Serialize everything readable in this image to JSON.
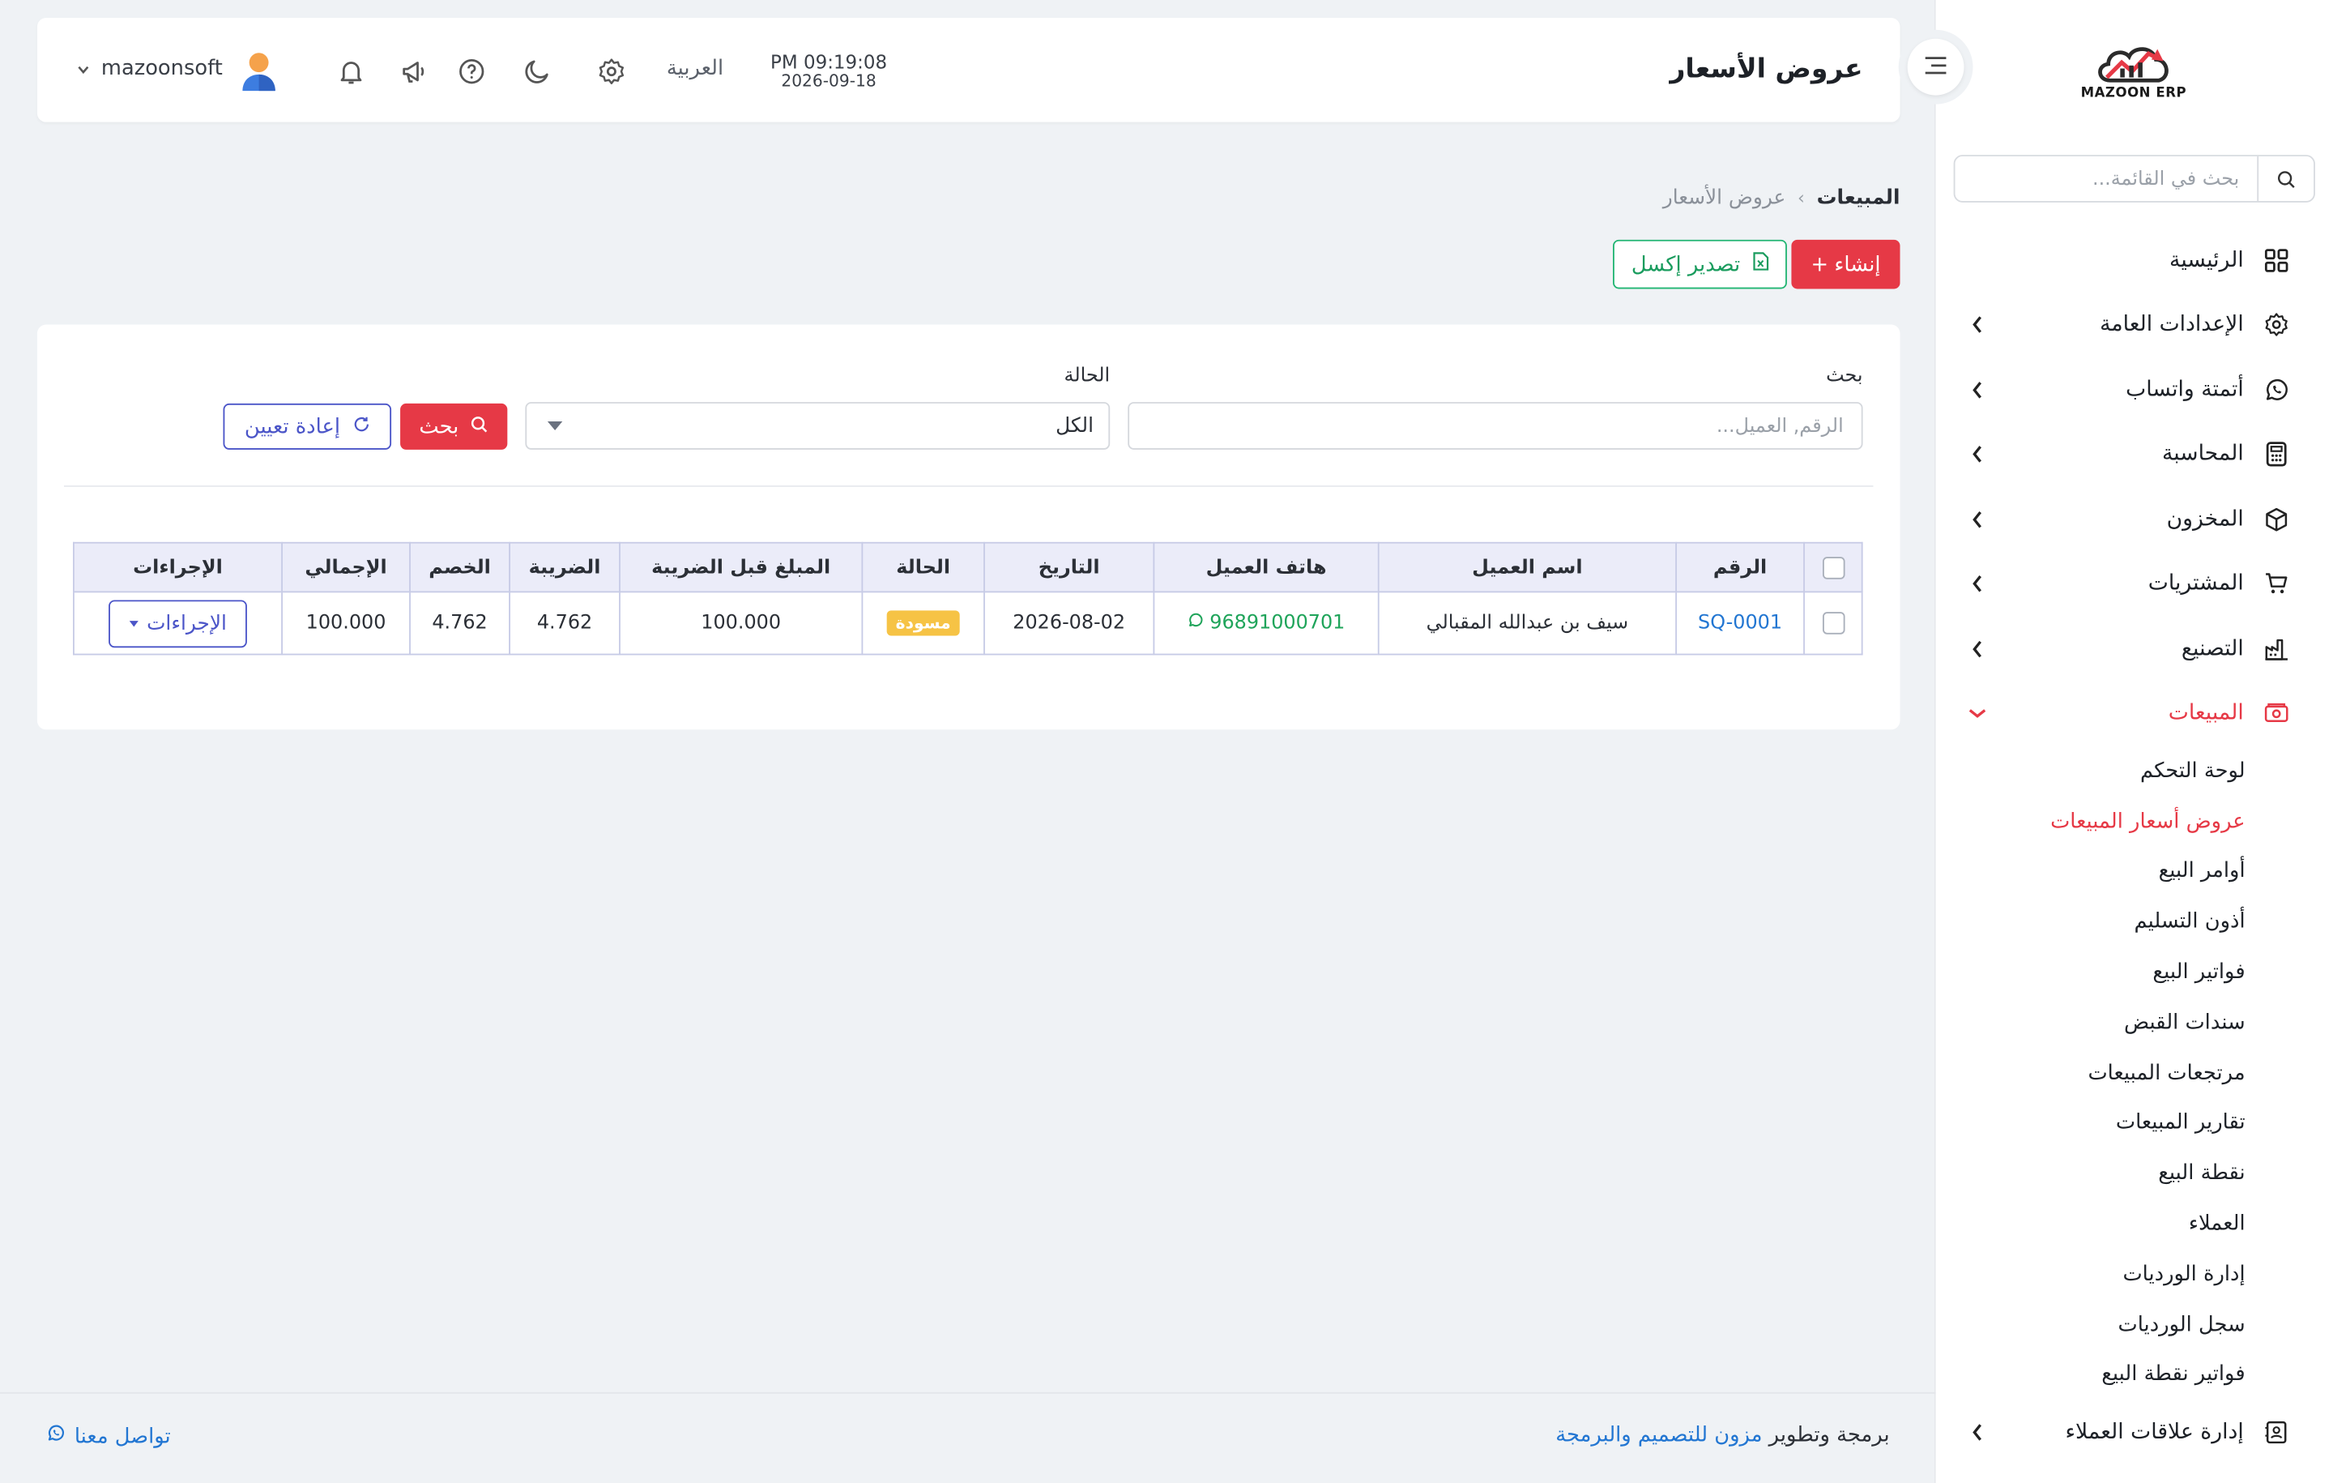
{
  "sidebar": {
    "logo_text": "MAZOON ERP",
    "search_placeholder": "بحث في القائمة...",
    "items": [
      {
        "label": "الرئيسية"
      },
      {
        "label": "الإعدادات العامة"
      },
      {
        "label": "أتمتة واتساب"
      },
      {
        "label": "المحاسبة"
      },
      {
        "label": "المخزون"
      },
      {
        "label": "المشتريات"
      },
      {
        "label": "التصنيع"
      },
      {
        "label": "المبيعات"
      },
      {
        "label": "إدارة علاقات العملاء"
      }
    ],
    "sales_submenu": [
      "لوحة التحكم",
      "عروض أسعار المبيعات",
      "أوامر البيع",
      "أذون التسليم",
      "فواتير البيع",
      "سندات القبض",
      "مرتجعات المبيعات",
      "تقارير المبيعات",
      "نقطة البيع",
      "العملاء",
      "إدارة الورديات",
      "سجل الورديات",
      "فواتير نقطة البيع"
    ]
  },
  "header": {
    "title": "عروض الأسعار",
    "time": "PM 09:19:08",
    "date": "2026-09-18",
    "language": "العربية",
    "username": "mazoonsoft"
  },
  "breadcrumb": {
    "root": "المبيعات",
    "current": "عروض الأسعار"
  },
  "actions": {
    "create_label": "إنشاء",
    "excel_label": "تصدير إكسل"
  },
  "filters": {
    "search_label": "بحث",
    "search_placeholder": "الرقم, العميل...",
    "status_label": "الحالة",
    "status_value": "الكل",
    "search_button": "بحث",
    "reset_button": "إعادة تعيين"
  },
  "table": {
    "columns": [
      "الرقم",
      "اسم العميل",
      "هاتف العميل",
      "التاريخ",
      "الحالة",
      "المبلغ قبل الضريبة",
      "الضريبة",
      "الخصم",
      "الإجمالي",
      "الإجراءات"
    ],
    "rows": [
      {
        "number": "SQ-0001",
        "customer": "سيف بن عبدالله المقبالي",
        "phone": "96891000701",
        "date": "2026-08-02",
        "status": "مسودة",
        "subtotal": "100.000",
        "tax": "4.762",
        "discount": "4.762",
        "total": "100.000",
        "actions_label": "الإجراءات"
      }
    ]
  },
  "footer": {
    "credit_prefix": "برمجة وتطوير",
    "credit_brand": "مزون للتصميم والبرمجة",
    "contact": "تواصل معنا"
  },
  "colors": {
    "accent_red": "#e63946",
    "accent_indigo": "#4b55c8",
    "success_green": "#1fa45a",
    "link_blue": "#2276d2",
    "draft_badge": "#f6c345"
  }
}
